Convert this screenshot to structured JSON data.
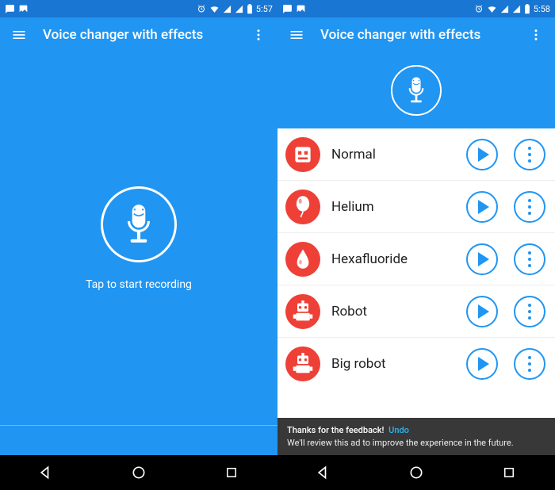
{
  "colors": {
    "primary": "#2095f2",
    "accent": "#ee4036"
  },
  "left": {
    "status_time": "5:57",
    "app_title": "Voice changer with effects",
    "tap_text": "Tap to start recording"
  },
  "right": {
    "status_time": "5:58",
    "app_title": "Voice changer with effects",
    "effects": [
      {
        "name": "Normal",
        "icon": "robot-face"
      },
      {
        "name": "Helium",
        "icon": "balloon"
      },
      {
        "name": "Hexafluoride",
        "icon": "drop"
      },
      {
        "name": "Robot",
        "icon": "robot"
      },
      {
        "name": "Big robot",
        "icon": "robot"
      }
    ],
    "snackbar": {
      "line1": "Thanks for the feedback!",
      "undo": "Undo",
      "line2": "We'll review this ad to improve the experience in the future."
    }
  }
}
